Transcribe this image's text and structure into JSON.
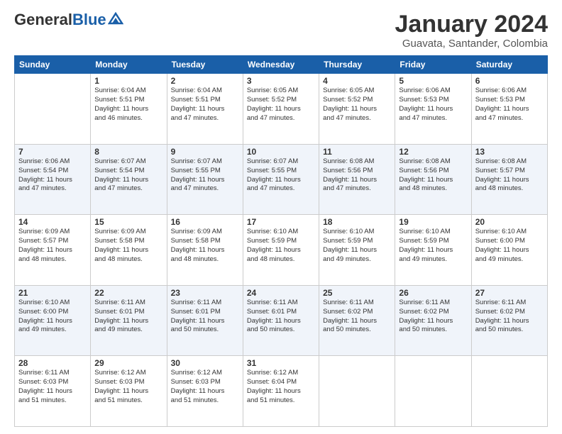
{
  "header": {
    "logo_general": "General",
    "logo_blue": "Blue",
    "month_title": "January 2024",
    "location": "Guavata, Santander, Colombia"
  },
  "weekdays": [
    "Sunday",
    "Monday",
    "Tuesday",
    "Wednesday",
    "Thursday",
    "Friday",
    "Saturday"
  ],
  "weeks": [
    [
      {
        "day": "",
        "info": ""
      },
      {
        "day": "1",
        "info": "Sunrise: 6:04 AM\nSunset: 5:51 PM\nDaylight: 11 hours\nand 46 minutes."
      },
      {
        "day": "2",
        "info": "Sunrise: 6:04 AM\nSunset: 5:51 PM\nDaylight: 11 hours\nand 47 minutes."
      },
      {
        "day": "3",
        "info": "Sunrise: 6:05 AM\nSunset: 5:52 PM\nDaylight: 11 hours\nand 47 minutes."
      },
      {
        "day": "4",
        "info": "Sunrise: 6:05 AM\nSunset: 5:52 PM\nDaylight: 11 hours\nand 47 minutes."
      },
      {
        "day": "5",
        "info": "Sunrise: 6:06 AM\nSunset: 5:53 PM\nDaylight: 11 hours\nand 47 minutes."
      },
      {
        "day": "6",
        "info": "Sunrise: 6:06 AM\nSunset: 5:53 PM\nDaylight: 11 hours\nand 47 minutes."
      }
    ],
    [
      {
        "day": "7",
        "info": "Sunrise: 6:06 AM\nSunset: 5:54 PM\nDaylight: 11 hours\nand 47 minutes."
      },
      {
        "day": "8",
        "info": "Sunrise: 6:07 AM\nSunset: 5:54 PM\nDaylight: 11 hours\nand 47 minutes."
      },
      {
        "day": "9",
        "info": "Sunrise: 6:07 AM\nSunset: 5:55 PM\nDaylight: 11 hours\nand 47 minutes."
      },
      {
        "day": "10",
        "info": "Sunrise: 6:07 AM\nSunset: 5:55 PM\nDaylight: 11 hours\nand 47 minutes."
      },
      {
        "day": "11",
        "info": "Sunrise: 6:08 AM\nSunset: 5:56 PM\nDaylight: 11 hours\nand 47 minutes."
      },
      {
        "day": "12",
        "info": "Sunrise: 6:08 AM\nSunset: 5:56 PM\nDaylight: 11 hours\nand 48 minutes."
      },
      {
        "day": "13",
        "info": "Sunrise: 6:08 AM\nSunset: 5:57 PM\nDaylight: 11 hours\nand 48 minutes."
      }
    ],
    [
      {
        "day": "14",
        "info": "Sunrise: 6:09 AM\nSunset: 5:57 PM\nDaylight: 11 hours\nand 48 minutes."
      },
      {
        "day": "15",
        "info": "Sunrise: 6:09 AM\nSunset: 5:58 PM\nDaylight: 11 hours\nand 48 minutes."
      },
      {
        "day": "16",
        "info": "Sunrise: 6:09 AM\nSunset: 5:58 PM\nDaylight: 11 hours\nand 48 minutes."
      },
      {
        "day": "17",
        "info": "Sunrise: 6:10 AM\nSunset: 5:59 PM\nDaylight: 11 hours\nand 48 minutes."
      },
      {
        "day": "18",
        "info": "Sunrise: 6:10 AM\nSunset: 5:59 PM\nDaylight: 11 hours\nand 49 minutes."
      },
      {
        "day": "19",
        "info": "Sunrise: 6:10 AM\nSunset: 5:59 PM\nDaylight: 11 hours\nand 49 minutes."
      },
      {
        "day": "20",
        "info": "Sunrise: 6:10 AM\nSunset: 6:00 PM\nDaylight: 11 hours\nand 49 minutes."
      }
    ],
    [
      {
        "day": "21",
        "info": "Sunrise: 6:10 AM\nSunset: 6:00 PM\nDaylight: 11 hours\nand 49 minutes."
      },
      {
        "day": "22",
        "info": "Sunrise: 6:11 AM\nSunset: 6:01 PM\nDaylight: 11 hours\nand 49 minutes."
      },
      {
        "day": "23",
        "info": "Sunrise: 6:11 AM\nSunset: 6:01 PM\nDaylight: 11 hours\nand 50 minutes."
      },
      {
        "day": "24",
        "info": "Sunrise: 6:11 AM\nSunset: 6:01 PM\nDaylight: 11 hours\nand 50 minutes."
      },
      {
        "day": "25",
        "info": "Sunrise: 6:11 AM\nSunset: 6:02 PM\nDaylight: 11 hours\nand 50 minutes."
      },
      {
        "day": "26",
        "info": "Sunrise: 6:11 AM\nSunset: 6:02 PM\nDaylight: 11 hours\nand 50 minutes."
      },
      {
        "day": "27",
        "info": "Sunrise: 6:11 AM\nSunset: 6:02 PM\nDaylight: 11 hours\nand 50 minutes."
      }
    ],
    [
      {
        "day": "28",
        "info": "Sunrise: 6:11 AM\nSunset: 6:03 PM\nDaylight: 11 hours\nand 51 minutes."
      },
      {
        "day": "29",
        "info": "Sunrise: 6:12 AM\nSunset: 6:03 PM\nDaylight: 11 hours\nand 51 minutes."
      },
      {
        "day": "30",
        "info": "Sunrise: 6:12 AM\nSunset: 6:03 PM\nDaylight: 11 hours\nand 51 minutes."
      },
      {
        "day": "31",
        "info": "Sunrise: 6:12 AM\nSunset: 6:04 PM\nDaylight: 11 hours\nand 51 minutes."
      },
      {
        "day": "",
        "info": ""
      },
      {
        "day": "",
        "info": ""
      },
      {
        "day": "",
        "info": ""
      }
    ]
  ]
}
